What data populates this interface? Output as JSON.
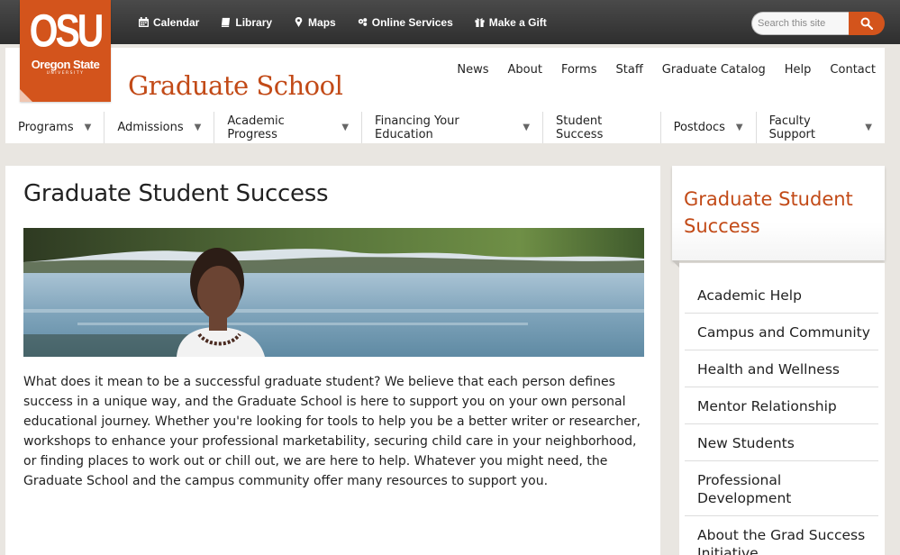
{
  "utility_nav": {
    "items": [
      {
        "label": "Calendar",
        "icon": "calendar-icon"
      },
      {
        "label": "Library",
        "icon": "book-icon"
      },
      {
        "label": "Maps",
        "icon": "map-marker-icon"
      },
      {
        "label": "Online Services",
        "icon": "gears-icon"
      },
      {
        "label": "Make a Gift",
        "icon": "gift-icon"
      }
    ]
  },
  "search": {
    "placeholder": "Search this site"
  },
  "logo": {
    "mark": "OSU",
    "line1": "Oregon State",
    "line2": "UNIVERSITY"
  },
  "site_title": "Graduate School",
  "secondary_nav": [
    "News",
    "About",
    "Forms",
    "Staff",
    "Graduate Catalog",
    "Help",
    "Contact"
  ],
  "primary_nav": [
    {
      "label": "Programs",
      "dropdown": true
    },
    {
      "label": "Admissions",
      "dropdown": true
    },
    {
      "label": "Academic Progress",
      "dropdown": true
    },
    {
      "label": "Financing Your Education",
      "dropdown": true
    },
    {
      "label": "Student Success",
      "dropdown": false
    },
    {
      "label": "Postdocs",
      "dropdown": true
    },
    {
      "label": "Faculty Support",
      "dropdown": true
    }
  ],
  "main": {
    "title": "Graduate Student Success",
    "intro": "What does it mean to be a successful graduate student? We believe that each person defines success in a unique way, and the Graduate School is here to support you on your own personal educational journey. Whether you're looking for tools to help you be a better writer or researcher, workshops to enhance your professional marketability, securing child care in your neighborhood, or finding places to work out or chill out, we are here to help. Whatever you might need, the Graduate School and the campus community offer many resources to support you."
  },
  "sidebar": {
    "title": "Graduate Student Success",
    "items": [
      "Academic Help",
      "Campus and Community",
      "Health and Wellness",
      "Mentor Relationship",
      "New Students",
      "Professional Development",
      "About the Grad Success Initiative"
    ]
  },
  "colors": {
    "accent": "#d3541c",
    "title": "#c24a17",
    "topbar": "#3a3a3a"
  }
}
